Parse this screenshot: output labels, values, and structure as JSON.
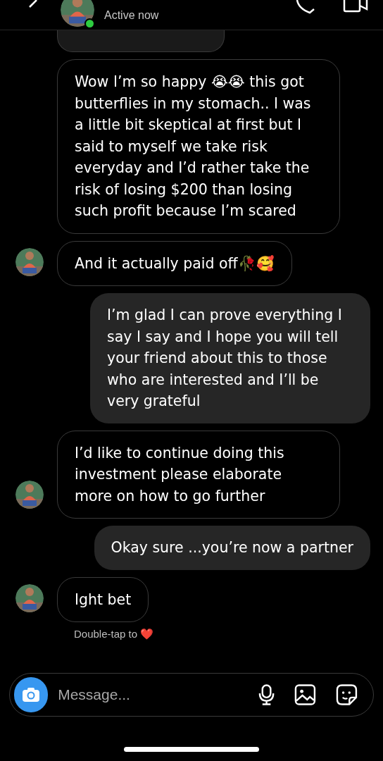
{
  "header": {
    "status": "Active now",
    "online": true
  },
  "messages": [
    {
      "kind": "incoming",
      "avatar": false,
      "text": "Wow I’m so happy 😭😭 this got butterflies in my stomach.. I was a little bit skeptical at first but I said to myself we take risk everyday and I’d rather take the risk of losing $200 than losing such profit because I’m scared"
    },
    {
      "kind": "incoming",
      "avatar": true,
      "text": "And it actually paid off🥀🥰"
    },
    {
      "kind": "outgoing",
      "text": "I’m glad I can prove everything I say I say and I hope you will tell your friend about this to those who are interested and I’ll be very grateful"
    },
    {
      "kind": "incoming",
      "avatar": true,
      "text": "I’d like to continue doing this investment please elaborate more on how to go further"
    },
    {
      "kind": "outgoing",
      "text": "Okay sure ...you’re now a partner"
    },
    {
      "kind": "incoming",
      "avatar": true,
      "text": "Ight bet",
      "caption": "Double-tap to ❤️"
    }
  ],
  "composer": {
    "placeholder": "Message..."
  }
}
